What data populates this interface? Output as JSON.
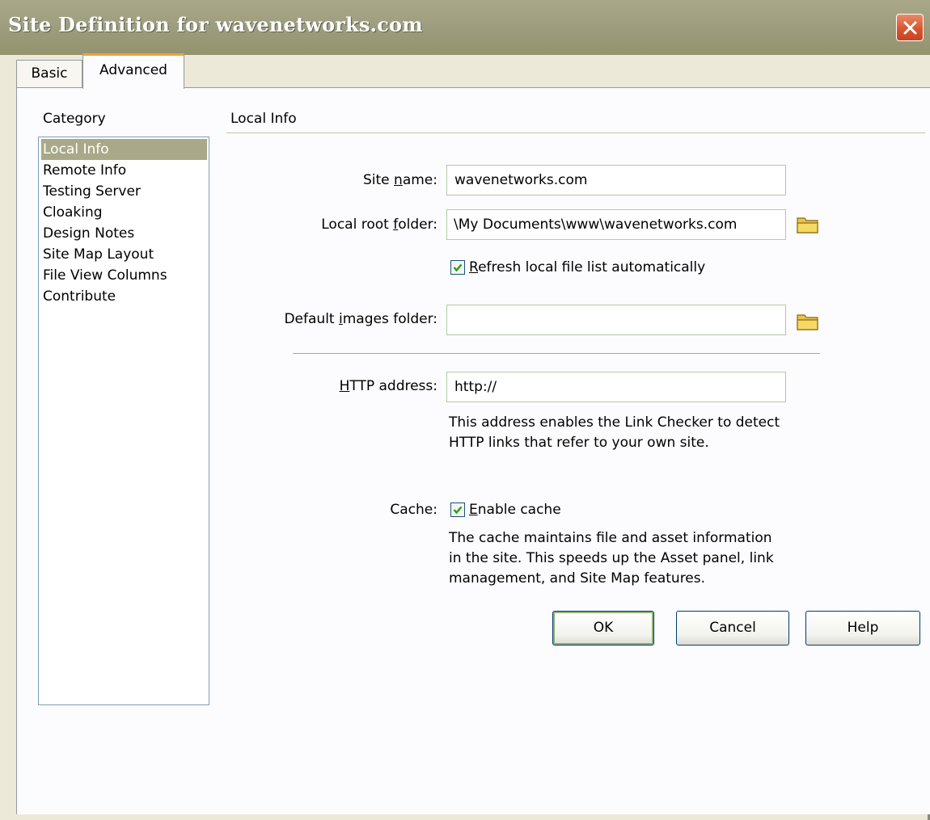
{
  "window": {
    "title": "Site Definition for wavenetworks.com"
  },
  "tabs": [
    {
      "label": "Basic"
    },
    {
      "label": "Advanced"
    }
  ],
  "category": {
    "label": "Category",
    "items": [
      {
        "label": "Local Info",
        "selected": true
      },
      {
        "label": "Remote Info"
      },
      {
        "label": "Testing Server"
      },
      {
        "label": "Cloaking"
      },
      {
        "label": "Design Notes"
      },
      {
        "label": "Site Map Layout"
      },
      {
        "label": "File View Columns"
      },
      {
        "label": "Contribute"
      }
    ]
  },
  "section": {
    "title": "Local Info"
  },
  "form": {
    "site_name": {
      "label_pre": "Site ",
      "label_accel": "n",
      "label_post": "ame:",
      "value": "wavenetworks.com"
    },
    "local_root": {
      "label_pre": "Local root ",
      "label_accel": "f",
      "label_post": "older:",
      "value": "\\My Documents\\www\\wavenetworks.com"
    },
    "refresh": {
      "checked": true,
      "label_accel": "R",
      "label_post": "efresh local file list automatically"
    },
    "default_images": {
      "label_pre": "Default ",
      "label_accel": "i",
      "label_post": "mages folder:",
      "value": ""
    },
    "http_address": {
      "label_accel": "H",
      "label_post": "TTP address:",
      "value": "http://",
      "help": "This address enables the Link Checker to detect HTTP links that refer to your own site."
    },
    "cache": {
      "label": "Cache:",
      "checked": true,
      "checkbox_accel": "E",
      "checkbox_post": "nable cache",
      "help": "The cache maintains file and asset information in the site.  This speeds up the Asset panel, link management, and Site Map features."
    }
  },
  "buttons": {
    "ok": "OK",
    "cancel": "Cancel",
    "help": "Help"
  },
  "colors": {
    "titlebar": "#9e9e80",
    "selection": "#a9a989",
    "close_button": "#d9562e",
    "checkmark": "#21a121",
    "tab_accent": "#f0a040"
  },
  "icons": {
    "close": "close-icon",
    "folder": "folder-icon",
    "check": "checkmark-icon"
  }
}
